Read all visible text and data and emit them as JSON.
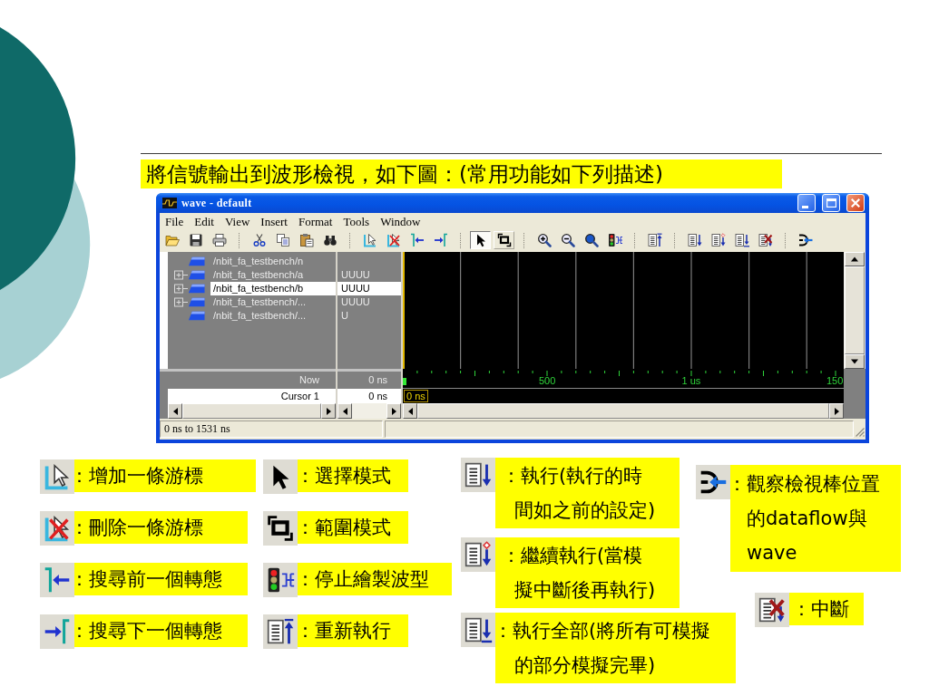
{
  "caption": "將信號輸出到波形檢視，如下圖：(常用功能如下列描述)",
  "window": {
    "title": "wave - default",
    "menu": [
      "File",
      "Edit",
      "View",
      "Insert",
      "Format",
      "Tools",
      "Window"
    ],
    "mode_buttons": [
      {
        "selected": true
      },
      {
        "selected": false
      }
    ],
    "signals": [
      {
        "name": "/nbit_fa_testbench/n",
        "kind": "bit",
        "selected": false
      },
      {
        "name": "/nbit_fa_testbench/a",
        "kind": "bus",
        "value": "UUUU",
        "selected": false
      },
      {
        "name": "/nbit_fa_testbench/b",
        "kind": "bus",
        "value": "UUUU",
        "selected": true
      },
      {
        "name": "/nbit_fa_testbench/...",
        "kind": "bus",
        "value": "UUUU",
        "selected": false
      },
      {
        "name": "/nbit_fa_testbench/...",
        "kind": "bit",
        "value": "U",
        "selected": false
      }
    ],
    "now": {
      "label": "Now",
      "value": "0 ns"
    },
    "cursor": {
      "label": "Cursor 1",
      "value": "0 ns",
      "selected": true,
      "marker": "0 ns"
    },
    "ruler_labels": [
      "500",
      "1 us",
      "150"
    ],
    "status": "0 ns to 1531 ns"
  },
  "legend": [
    [
      "：增加一條游標",
      "：刪除一條游標",
      "：搜尋前一個轉態",
      "：搜尋下一個轉態"
    ],
    [
      "：選擇模式",
      "：範圍模式",
      "：停止繪製波型",
      "：重新執行"
    ],
    [
      "：執行(執行的時間如之前的設定)",
      "：繼續執行(當模擬中斷後再執行)",
      "：執行全部(將所有可模擬的部分模擬完畢)"
    ],
    [
      "：觀察檢視棒位置的dataflow與wave",
      "：中斷"
    ]
  ]
}
